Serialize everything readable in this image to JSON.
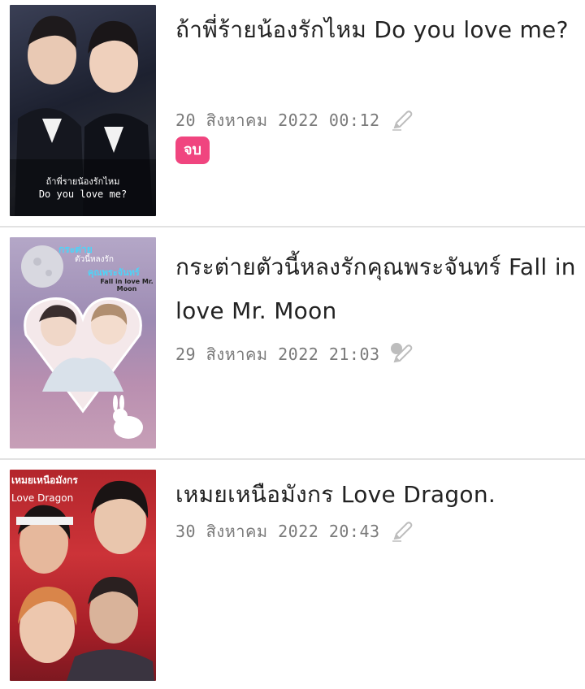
{
  "items": [
    {
      "title": "ถ้าพี่ร้ายน้องรักไหม Do you love me?",
      "date": "20 สิงหาคม 2022 00:12",
      "edit_icon": "pen-icon",
      "badge": "จบ",
      "cover_line1": "ถ้าพี่รายน้องรักไหม",
      "cover_line2": "Do you love me?"
    },
    {
      "title": "กระต่ายตัวนี้หลงรักคุณพระจันทร์ Fall in love Mr. Moon",
      "date": "29 สิงหาคม 2022 21:03",
      "edit_icon": "joy-pen-icon",
      "cover_line1": "กระต่าย",
      "cover_line2": "ตัวนี้หลงรัก",
      "cover_line3": "คุณพระจันทร์",
      "cover_line4": "Fall in love Mr. Moon"
    },
    {
      "title": "เหมยเหนือมังกร Love Dragon.",
      "date": "30 สิงหาคม 2022 20:43",
      "edit_icon": "pen-icon",
      "cover_line1": "เหมยเหนือมังกร",
      "cover_line2": "Love Dragon"
    }
  ]
}
